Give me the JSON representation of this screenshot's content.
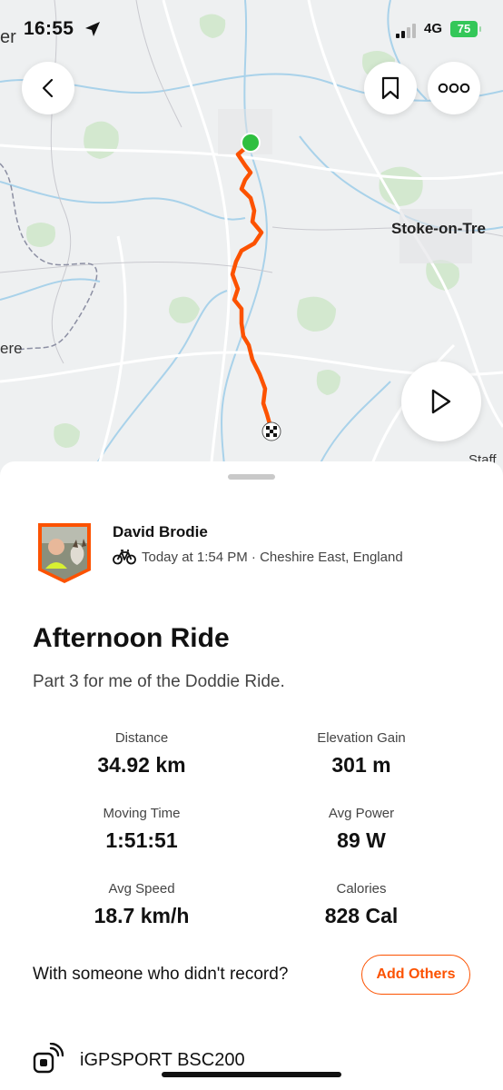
{
  "status_bar": {
    "time": "16:55",
    "network": "4G",
    "battery": "75",
    "left_edge_text": "er"
  },
  "map": {
    "places": {
      "stoke": "Stoke-on-Tre",
      "left_edge": "ere",
      "bottom_right": "Staff"
    },
    "route_color": "#fc5200",
    "start_marker_color": "#2fbf3f"
  },
  "nav": {
    "back_icon": "chevron-left-icon",
    "save_icon": "bookmark-icon",
    "more_icon": "more-dots-icon",
    "play_icon": "play-icon"
  },
  "activity": {
    "athlete": "David Brodie",
    "meta": "Today at 1:54 PM · Cheshire East, England",
    "sport_icon": "bike-icon",
    "title": "Afternoon Ride",
    "description": "Part 3 for me of the Doddie Ride."
  },
  "stats": [
    {
      "label": "Distance",
      "value": "34.92 km"
    },
    {
      "label": "Elevation Gain",
      "value": "301 m"
    },
    {
      "label": "Moving Time",
      "value": "1:51:51"
    },
    {
      "label": "Avg Power",
      "value": "89 W"
    },
    {
      "label": "Avg Speed",
      "value": "18.7 km/h"
    },
    {
      "label": "Calories",
      "value": "828 Cal"
    }
  ],
  "with_others": {
    "prompt": "With someone who didn't record?",
    "button": "Add Others"
  },
  "device": {
    "name": "iGPSPORT BSC200"
  },
  "colors": {
    "accent": "#fc5200",
    "battery": "#34c759"
  }
}
